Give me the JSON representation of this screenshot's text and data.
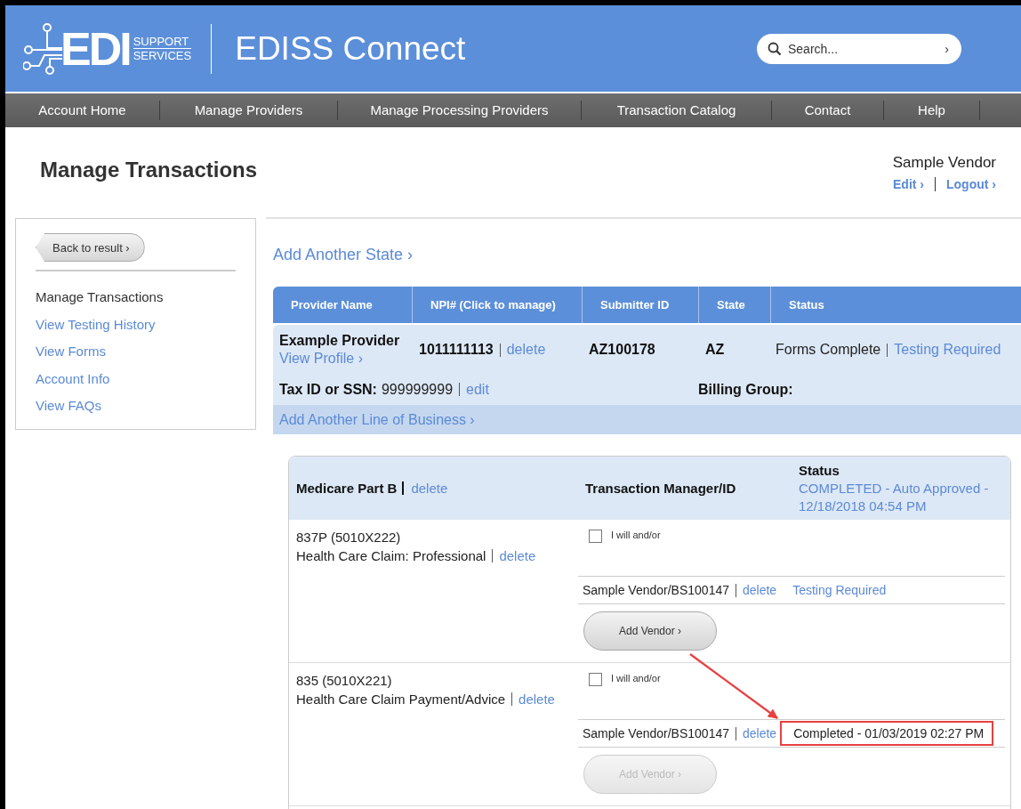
{
  "header": {
    "logo": {
      "mark": "EDI",
      "line1": "SUPPORT",
      "line2": "SERVICES"
    },
    "title": "EDISS Connect",
    "search": {
      "placeholder": "Search...",
      "go": "›"
    }
  },
  "nav": [
    {
      "label": "Account Home"
    },
    {
      "label": "Manage Providers"
    },
    {
      "label": "Manage Processing Providers"
    },
    {
      "label": "Transaction Catalog"
    },
    {
      "label": "Contact"
    },
    {
      "label": "Help"
    }
  ],
  "page": {
    "title": "Manage Transactions",
    "user": "Sample Vendor",
    "user_links": [
      "Edit ›",
      "Logout ›"
    ]
  },
  "sidebar": {
    "back_button": "Back to result ›",
    "items": [
      {
        "label": "Manage Transactions",
        "selected": true
      },
      {
        "label": "View Testing History",
        "selected": false
      },
      {
        "label": "View Forms",
        "selected": false
      },
      {
        "label": "Account Info",
        "selected": false
      },
      {
        "label": "View FAQs",
        "selected": false
      }
    ]
  },
  "add_state": "Add Another State ›",
  "providers_table": {
    "columns": [
      "Provider Name",
      "NPI# (Click to manage)",
      "Submitter ID",
      "State",
      "Status"
    ],
    "rows": [
      {
        "name": "Example Provider",
        "view_profile": "View Profile ›",
        "npi": "1011111113",
        "npi_action": "delete",
        "submitter_id": "AZ100178",
        "state": "AZ",
        "status": "Forms Complete",
        "status_link": "Testing Required",
        "tax_label": "Tax ID or SSN:",
        "tax_value": "999999999",
        "tax_action": "edit",
        "billing_label": "Billing Group:",
        "add_line": "Add Another Line of Business ›"
      }
    ]
  },
  "business_line": {
    "name": "Medicare Part B",
    "action": "delete",
    "manager_heading": "Transaction Manager/ID",
    "status_heading": "Status",
    "status": "COMPLETED - Auto Approved - 12/18/2018 04:54 PM",
    "transactions": [
      {
        "code": "837P (5010X222)",
        "description": "Health Care Claim: Professional",
        "action": "delete",
        "checkbox_label": "I will and/or",
        "checked": false,
        "vendor": "Sample Vendor/BS100147",
        "vendor_action": "delete",
        "vendor_status": {
          "kind": "link",
          "text": "Testing Required"
        },
        "highlighted": false,
        "add_vendor": "Add Vendor ›",
        "add_vendor_disabled": false
      },
      {
        "code": "835 (5010X221)",
        "description": "Health Care Claim Payment/Advice",
        "action": "delete",
        "checkbox_label": "I will and/or",
        "checked": false,
        "vendor": "Sample Vendor/BS100147",
        "vendor_action": "delete",
        "vendor_status": {
          "kind": "plain",
          "text": "Completed - 01/03/2019 02:27 PM"
        },
        "highlighted": true,
        "add_vendor": "Add Vendor ›",
        "add_vendor_disabled": true
      }
    ]
  }
}
